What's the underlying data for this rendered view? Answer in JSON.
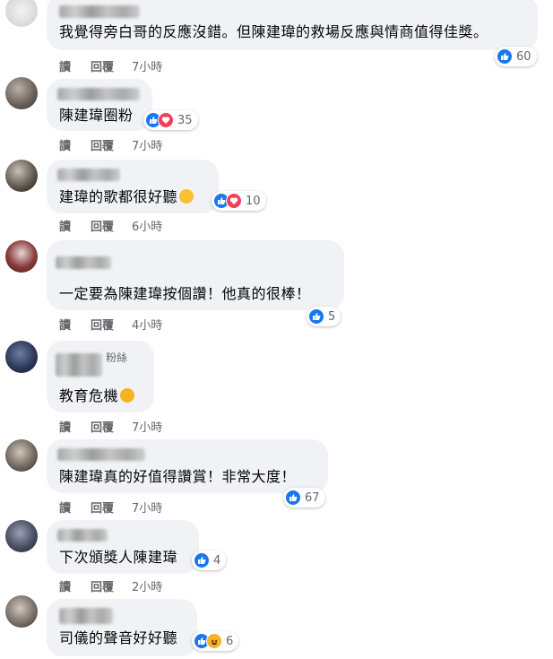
{
  "comments": [
    {
      "text": "我覺得旁白哥的反應沒錯。但陳建瑋的救場反應與情商值得佳獎。",
      "reactions": "60",
      "time": "7小時"
    },
    {
      "text": "陳建瑋圈粉",
      "reactions": "35",
      "time": "7小時"
    },
    {
      "text": "建瑋的歌都很好聽",
      "reactions": "10",
      "time": "6小時"
    },
    {
      "text": "一定要為陳建瑋按個讚！他真的很棒！",
      "reactions": "5",
      "time": "4小時"
    },
    {
      "badge": "粉絲",
      "text": "教育危機",
      "time": "7小時"
    },
    {
      "text": "陳建瑋真的好值得讚賞！非常大度！",
      "reactions": "67",
      "time": "7小時"
    },
    {
      "text": "下次頒獎人陳建瑋",
      "reactions": "4",
      "time": "2小時"
    },
    {
      "text": "司儀的聲音好好聽",
      "reactions": "6"
    }
  ],
  "actions": {
    "read": "讀",
    "reply": "回覆"
  },
  "colors": {
    "like": "#1877f2",
    "love": "#f33e58",
    "haha": "#f7b125",
    "bubble": "#f0f2f5"
  }
}
